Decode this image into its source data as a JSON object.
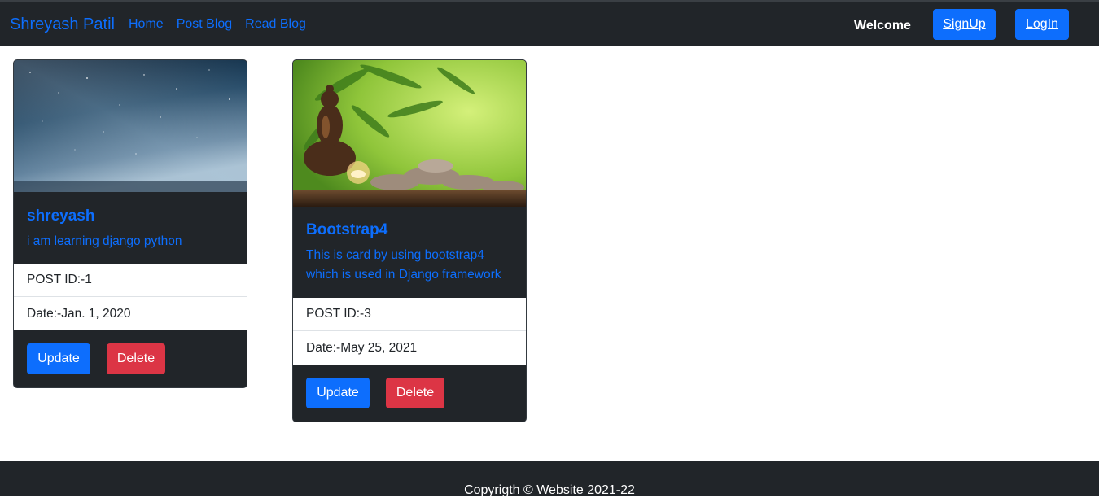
{
  "navbar": {
    "brand": "Shreyash Patil",
    "links": [
      "Home",
      "Post Blog",
      "Read Blog"
    ],
    "welcome": "Welcome",
    "signup_label": "SignUp",
    "login_label": "LogIn"
  },
  "posts": [
    {
      "title": "shreyash",
      "text": "i am learning django python",
      "post_id": "POST ID:-1",
      "date": "Date:-Jan. 1, 2020",
      "update_label": "Update",
      "delete_label": "Delete"
    },
    {
      "title": "Bootstrap4",
      "text": "This is card by using bootstrap4 which is used in Django framework",
      "post_id": "POST ID:-3",
      "date": "Date:-May 25, 2021",
      "update_label": "Update",
      "delete_label": "Delete"
    }
  ],
  "footer": {
    "text": "Copyrigth © Website 2021-22"
  },
  "colors": {
    "navbar_bg": "#212529",
    "primary": "#0d6efd",
    "danger": "#dc3545"
  }
}
